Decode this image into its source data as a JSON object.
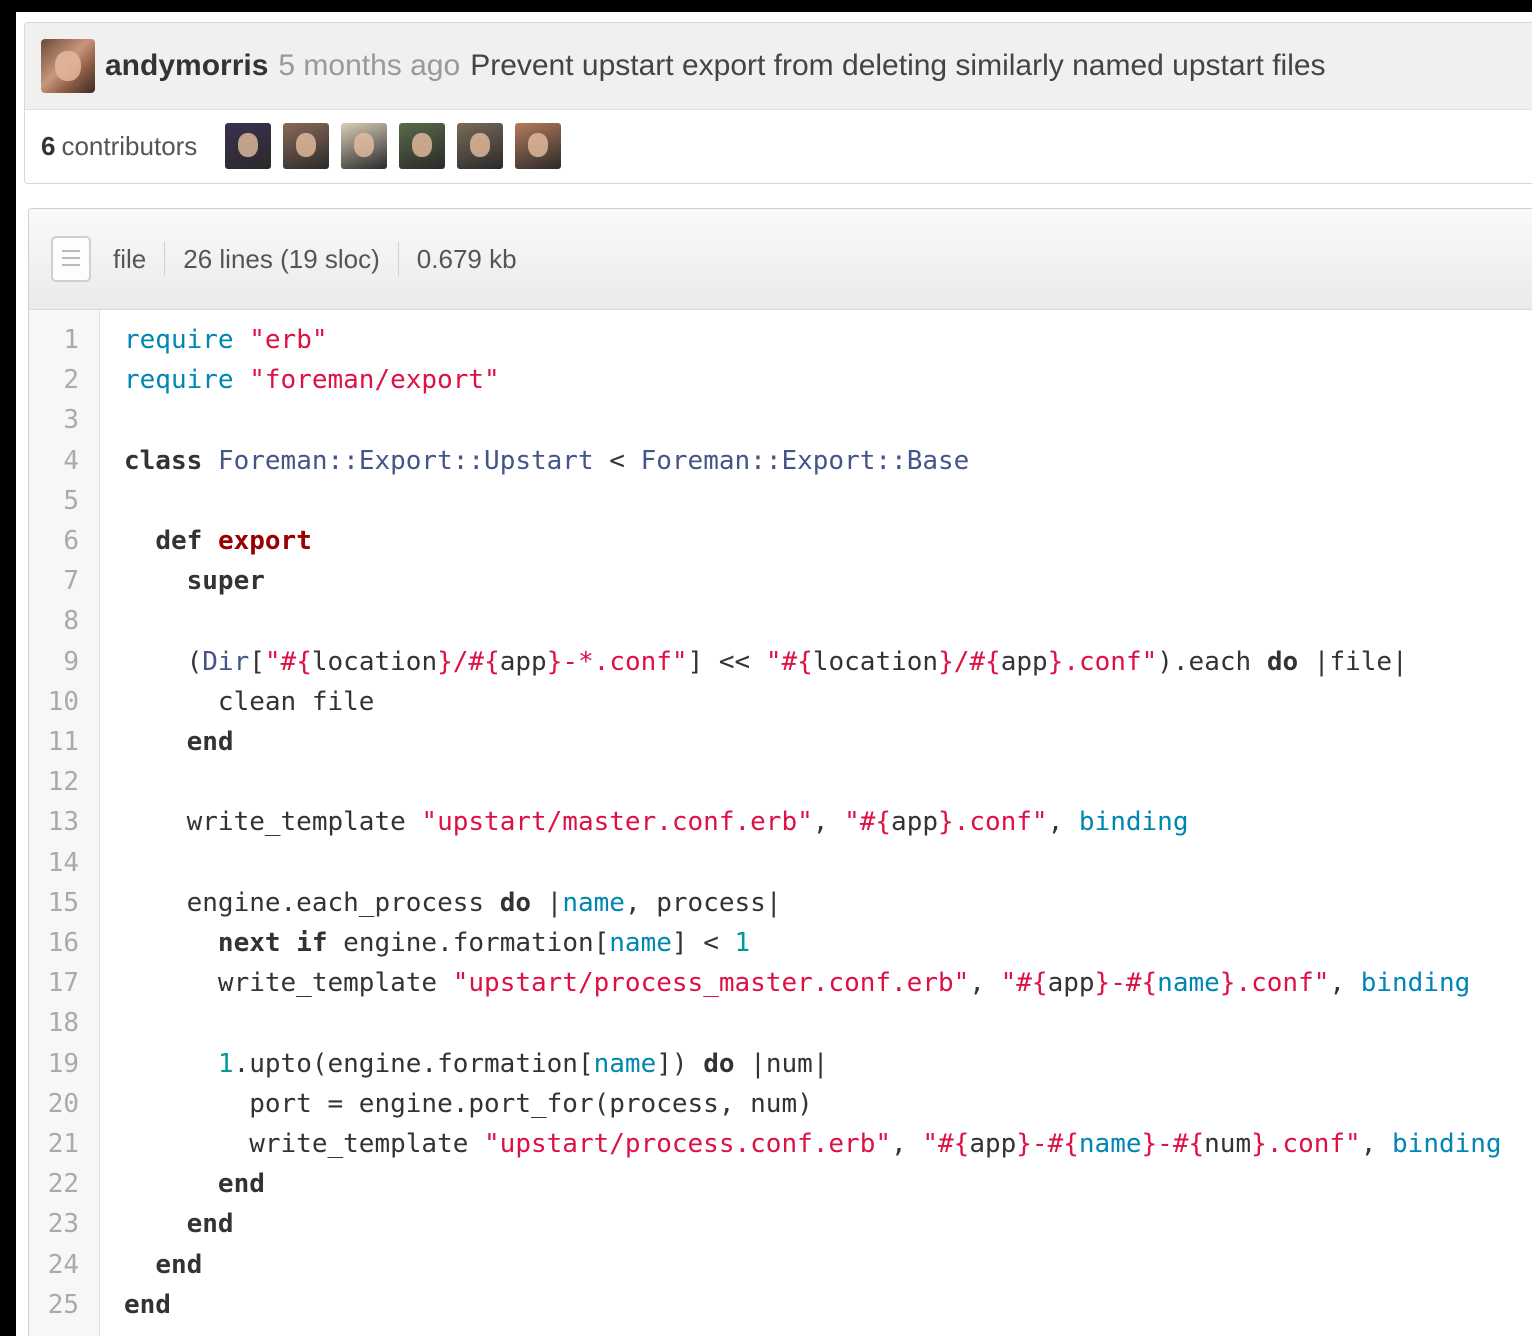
{
  "commit": {
    "author": "andymorris",
    "time": "5 months ago",
    "message": "Prevent upstart export from deleting similarly named upstart files"
  },
  "contributors": {
    "count": "6",
    "label": "contributors",
    "avatars": [
      "#3b3150",
      "#8a6a5a",
      "#d9cdb8",
      "#5a6a4a",
      "#7a6a5a",
      "#b47a5a"
    ]
  },
  "file_info": {
    "type": "file",
    "lines": "26 lines (19 sloc)",
    "size": "0.679 kb"
  },
  "code_lines": [
    {
      "num": "1",
      "segments": [
        {
          "t": "require",
          "c": "req"
        },
        {
          "t": " "
        },
        {
          "t": "\"erb\"",
          "c": "s"
        }
      ]
    },
    {
      "num": "2",
      "segments": [
        {
          "t": "require",
          "c": "req"
        },
        {
          "t": " "
        },
        {
          "t": "\"foreman/export\"",
          "c": "s"
        }
      ]
    },
    {
      "num": "3",
      "segments": []
    },
    {
      "num": "4",
      "segments": [
        {
          "t": "class",
          "c": "k"
        },
        {
          "t": " "
        },
        {
          "t": "Foreman::Export::Upstart",
          "c": "c"
        },
        {
          "t": " < "
        },
        {
          "t": "Foreman::Export::Base",
          "c": "c"
        }
      ]
    },
    {
      "num": "5",
      "segments": []
    },
    {
      "num": "6",
      "segments": [
        {
          "t": "  "
        },
        {
          "t": "def",
          "c": "k"
        },
        {
          "t": " "
        },
        {
          "t": "export",
          "c": "ki"
        }
      ]
    },
    {
      "num": "7",
      "segments": [
        {
          "t": "    "
        },
        {
          "t": "super",
          "c": "k"
        }
      ]
    },
    {
      "num": "8",
      "segments": []
    },
    {
      "num": "9",
      "segments": [
        {
          "t": "    ("
        },
        {
          "t": "Dir",
          "c": "c"
        },
        {
          "t": "["
        },
        {
          "t": "\"#{",
          "c": "s"
        },
        {
          "t": "location"
        },
        {
          "t": "}/#{",
          "c": "s"
        },
        {
          "t": "app"
        },
        {
          "t": "}-*.conf\"",
          "c": "s"
        },
        {
          "t": "] << "
        },
        {
          "t": "\"#{",
          "c": "s"
        },
        {
          "t": "location"
        },
        {
          "t": "}/#{",
          "c": "s"
        },
        {
          "t": "app"
        },
        {
          "t": "}.conf\"",
          "c": "s"
        },
        {
          "t": ").each "
        },
        {
          "t": "do",
          "c": "k"
        },
        {
          "t": " |file|"
        }
      ]
    },
    {
      "num": "10",
      "segments": [
        {
          "t": "      clean file"
        }
      ]
    },
    {
      "num": "11",
      "segments": [
        {
          "t": "    "
        },
        {
          "t": "end",
          "c": "k"
        }
      ]
    },
    {
      "num": "12",
      "segments": []
    },
    {
      "num": "13",
      "segments": [
        {
          "t": "    write_template "
        },
        {
          "t": "\"upstart/master.conf.erb\"",
          "c": "s"
        },
        {
          "t": ", "
        },
        {
          "t": "\"#{",
          "c": "s"
        },
        {
          "t": "app"
        },
        {
          "t": "}.conf\"",
          "c": "s"
        },
        {
          "t": ", "
        },
        {
          "t": "binding",
          "c": "n"
        }
      ]
    },
    {
      "num": "14",
      "segments": []
    },
    {
      "num": "15",
      "segments": [
        {
          "t": "    engine.each_process "
        },
        {
          "t": "do",
          "c": "k"
        },
        {
          "t": " |"
        },
        {
          "t": "name",
          "c": "n"
        },
        {
          "t": ", process|"
        }
      ]
    },
    {
      "num": "16",
      "segments": [
        {
          "t": "      "
        },
        {
          "t": "next",
          "c": "k"
        },
        {
          "t": " "
        },
        {
          "t": "if",
          "c": "k"
        },
        {
          "t": " engine.formation["
        },
        {
          "t": "name",
          "c": "n"
        },
        {
          "t": "] < "
        },
        {
          "t": "1",
          "c": "num"
        }
      ]
    },
    {
      "num": "17",
      "segments": [
        {
          "t": "      write_template "
        },
        {
          "t": "\"upstart/process_master.conf.erb\"",
          "c": "s"
        },
        {
          "t": ", "
        },
        {
          "t": "\"#{",
          "c": "s"
        },
        {
          "t": "app"
        },
        {
          "t": "}-#{",
          "c": "s"
        },
        {
          "t": "name",
          "c": "n"
        },
        {
          "t": "}.conf\"",
          "c": "s"
        },
        {
          "t": ", "
        },
        {
          "t": "binding",
          "c": "n"
        }
      ]
    },
    {
      "num": "18",
      "segments": []
    },
    {
      "num": "19",
      "segments": [
        {
          "t": "      "
        },
        {
          "t": "1",
          "c": "num"
        },
        {
          "t": ".upto(engine.formation["
        },
        {
          "t": "name",
          "c": "n"
        },
        {
          "t": "]) "
        },
        {
          "t": "do",
          "c": "k"
        },
        {
          "t": " |num|"
        }
      ]
    },
    {
      "num": "20",
      "segments": [
        {
          "t": "        port = engine.port_for(process, num)"
        }
      ]
    },
    {
      "num": "21",
      "segments": [
        {
          "t": "        write_template "
        },
        {
          "t": "\"upstart/process.conf.erb\"",
          "c": "s"
        },
        {
          "t": ", "
        },
        {
          "t": "\"#{",
          "c": "s"
        },
        {
          "t": "app"
        },
        {
          "t": "}-#{",
          "c": "s"
        },
        {
          "t": "name",
          "c": "n"
        },
        {
          "t": "}-#{",
          "c": "s"
        },
        {
          "t": "num"
        },
        {
          "t": "}.conf\"",
          "c": "s"
        },
        {
          "t": ", "
        },
        {
          "t": "binding",
          "c": "n"
        }
      ]
    },
    {
      "num": "22",
      "segments": [
        {
          "t": "      "
        },
        {
          "t": "end",
          "c": "k"
        }
      ]
    },
    {
      "num": "23",
      "segments": [
        {
          "t": "    "
        },
        {
          "t": "end",
          "c": "k"
        }
      ]
    },
    {
      "num": "24",
      "segments": [
        {
          "t": "  "
        },
        {
          "t": "end",
          "c": "k"
        }
      ]
    },
    {
      "num": "25",
      "segments": [
        {
          "t": "end",
          "c": "k"
        }
      ]
    }
  ]
}
